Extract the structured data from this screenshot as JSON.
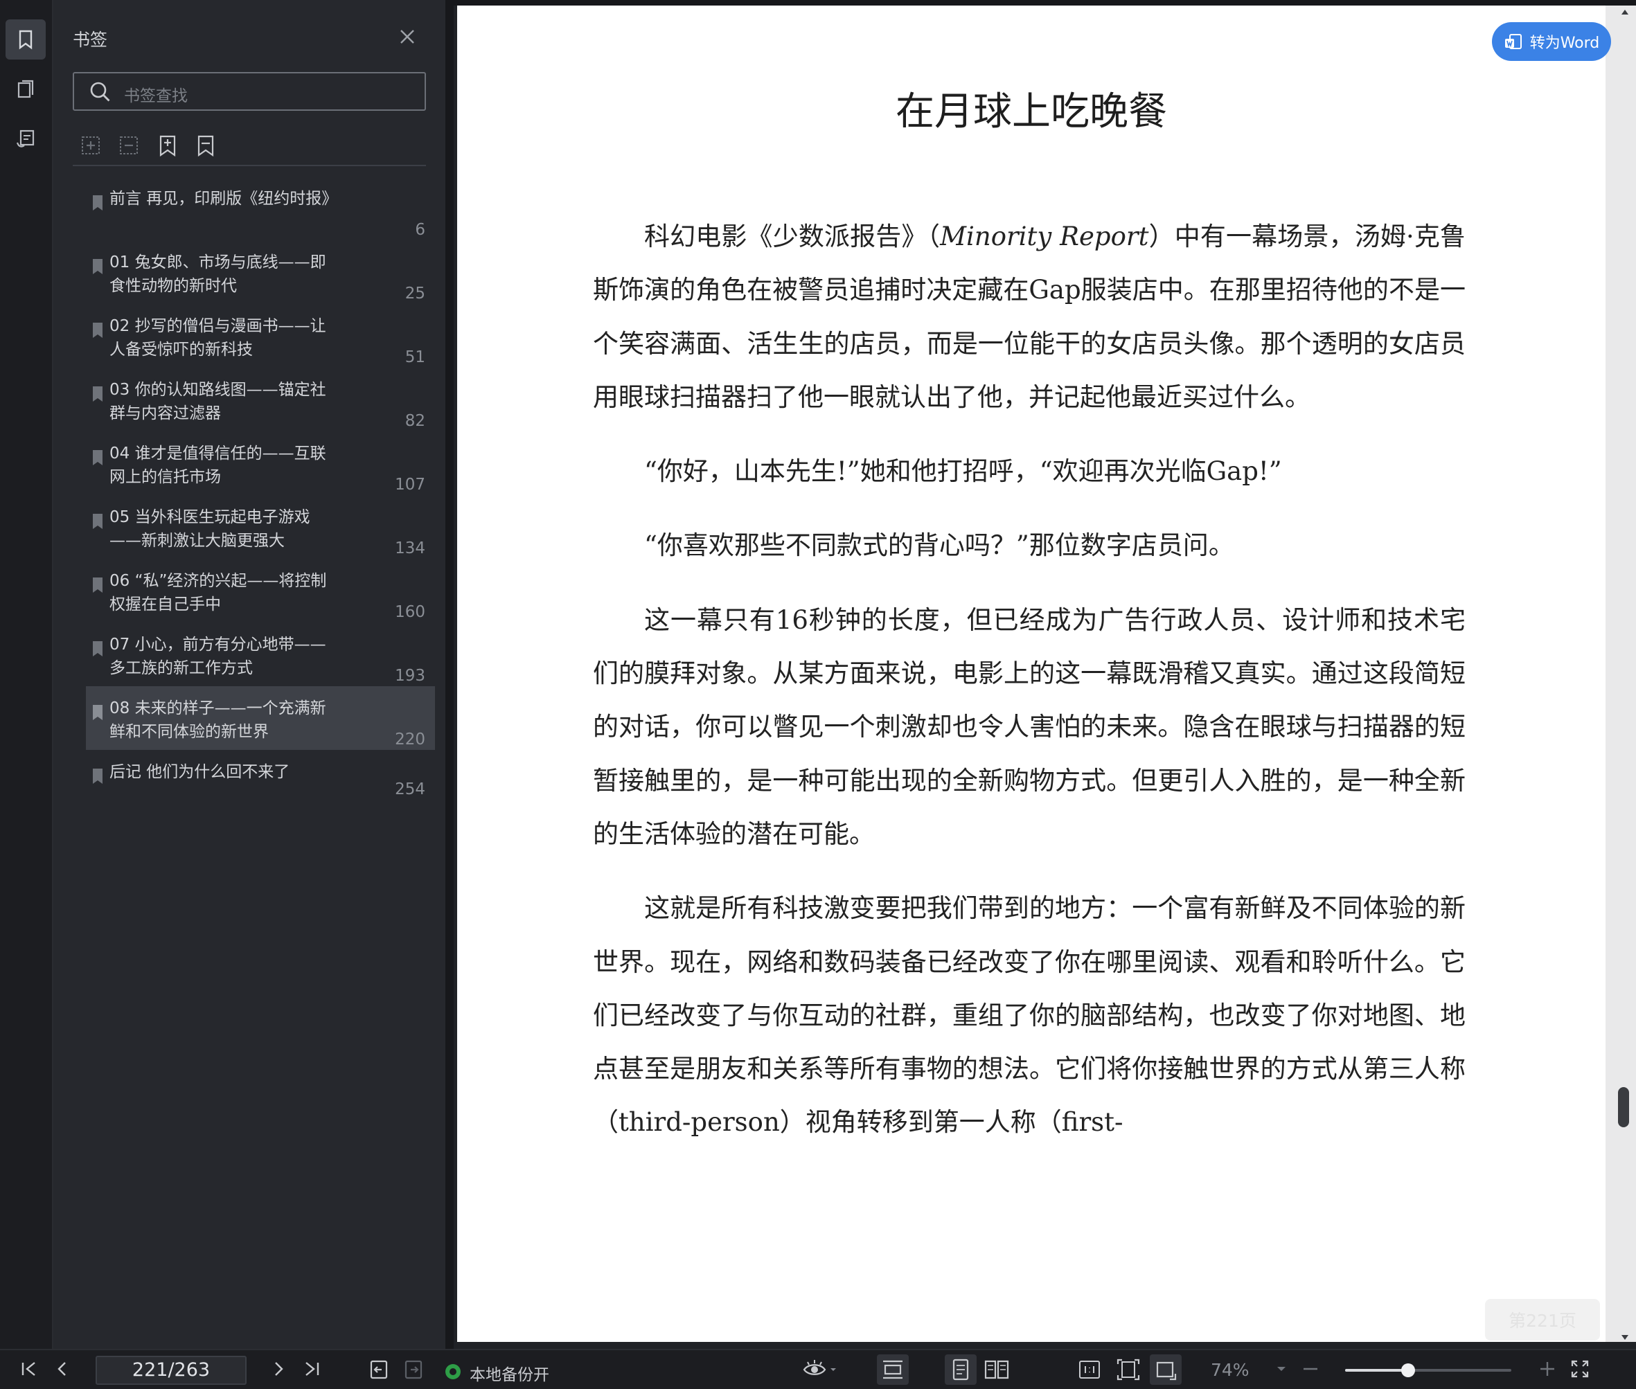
{
  "sidebar": {
    "title": "书签",
    "search_placeholder": "书签查找",
    "bookmarks": [
      {
        "label": "前言 再见，印刷版《纽约时报》",
        "page": "6"
      },
      {
        "label": "01 兔女郎、市场与底线——即食性动物的新时代",
        "page": "25"
      },
      {
        "label": "02 抄写的僧侣与漫画书——让人备受惊吓的新科技",
        "page": "51"
      },
      {
        "label": "03 你的认知路线图——锚定社群与内容过滤器",
        "page": "82"
      },
      {
        "label": "04 谁才是值得信任的——互联网上的信托市场",
        "page": "107"
      },
      {
        "label": "05 当外科医生玩起电子游戏——新刺激让大脑更强大",
        "page": "134"
      },
      {
        "label": "06 “私”经济的兴起——将控制权握在自己手中",
        "page": "160"
      },
      {
        "label": "07 小心，前方有分心地带——多工族的新工作方式",
        "page": "193"
      },
      {
        "label": "08 未来的样子——一个充满新鲜和不同体验的新世界",
        "page": "220",
        "selected": true
      },
      {
        "label": "后记 他们为什么回不来了",
        "page": "254"
      }
    ]
  },
  "document": {
    "chapter_title": "在月球上吃晚餐",
    "p1_a": "科幻电影《少数派报告》（",
    "p1_em": "Minority Report",
    "p1_b": "）中有一幕场景，汤姆·克鲁斯饰演的角色在被警员追捕时决定藏在Gap服装店中。在那里招待他的不是一个笑容满面、活生生的店员，而是一位能干的女店员头像。那个透明的女店员用眼球扫描器扫了他一眼就认出了他，并记起他最近买过什么。",
    "p2": "“你好，山本先生!”她和他打招呼，“欢迎再次光临Gap!”",
    "p3": "“你喜欢那些不同款式的背心吗？”那位数字店员问。",
    "p4": "这一幕只有16秒钟的长度，但已经成为广告行政人员、设计师和技术宅们的膜拜对象。从某方面来说，电影上的这一幕既滑稽又真实。通过这段简短的对话，你可以瞥见一个刺激却也令人害怕的未来。隐含在眼球与扫描器的短暂接触里的，是一种可能出现的全新购物方式。但更引人入胜的，是一种全新的生活体验的潜在可能。",
    "p5": "这就是所有科技激变要把我们带到的地方：一个富有新鲜及不同体验的新世界。现在，网络和数码装备已经改变了你在哪里阅读、观看和聆听什么。它们已经改变了与你互动的社群，重组了你的脑部结构，也改变了你对地图、地点甚至是朋友和关系等所有事物的想法。它们将你接触世界的方式从第三人称（third-person）视角转移到第一人称（first-",
    "convert_button": "转为Word",
    "page_badge": "第221页"
  },
  "statusbar": {
    "page_indicator": "221/263",
    "backup_status": "本地备份开",
    "zoom": "74%",
    "zoom_level": 0.38
  },
  "colors": {
    "accent": "#3b82e6",
    "backup_green": "#2e9e47"
  }
}
